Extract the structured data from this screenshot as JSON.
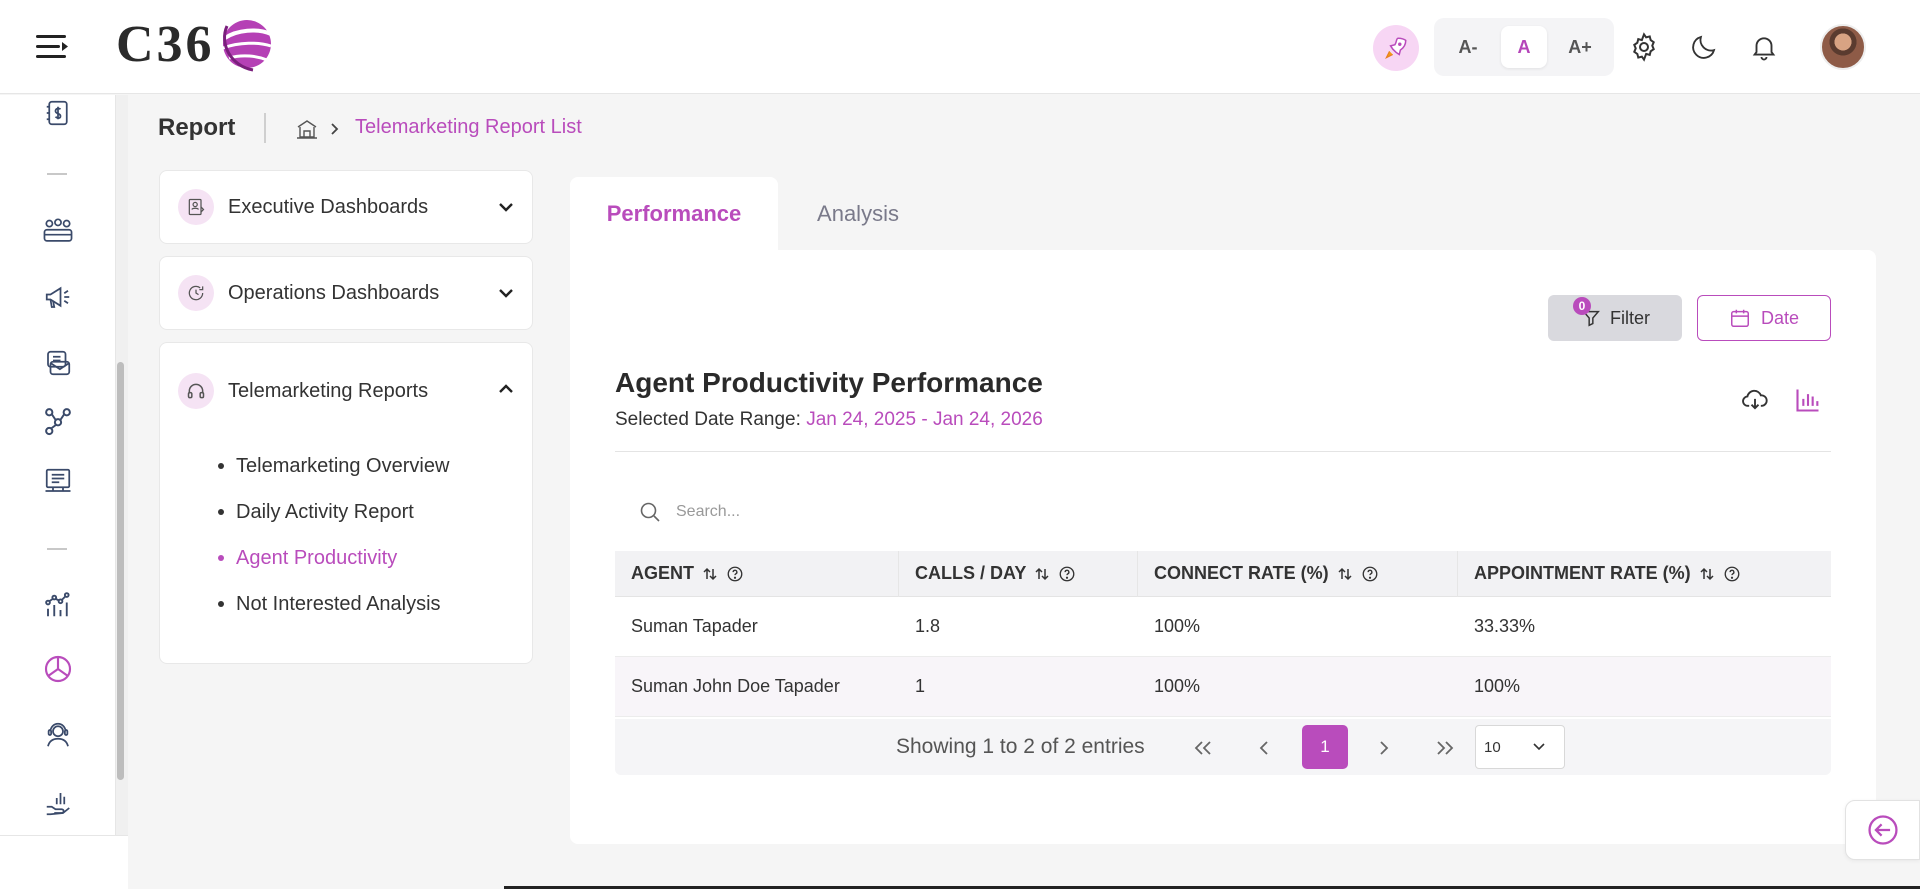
{
  "header": {
    "logo_text": "C36",
    "font_size_controls": [
      "A-",
      "A",
      "A+"
    ],
    "active_font_size": "A",
    "accent_color": "#b94cbc"
  },
  "breadcrumb": {
    "page_title": "Report",
    "current": "Telemarketing Report List"
  },
  "sidebar_menu": {
    "executive": "Executive Dashboards",
    "operations": "Operations Dashboards",
    "telemarketing": "Telemarketing Reports",
    "telemarketing_items": [
      "Telemarketing Overview",
      "Daily Activity Report",
      "Agent Productivity",
      "Not Interested Analysis"
    ],
    "active_item": "Agent Productivity"
  },
  "tabs": {
    "performance": "Performance",
    "analysis": "Analysis",
    "active": "Performance"
  },
  "toolbar": {
    "filter_label": "Filter",
    "filter_count": "0",
    "date_label": "Date"
  },
  "report": {
    "title": "Agent Productivity Performance",
    "range_label": "Selected Date Range:",
    "range_value": "Jan 24, 2025 - Jan 24, 2026"
  },
  "search": {
    "placeholder": "Search..."
  },
  "table": {
    "headers": [
      "AGENT",
      "CALLS / DAY",
      "CONNECT RATE (%)",
      "APPOINTMENT RATE (%)"
    ],
    "rows": [
      [
        "Suman Tapader",
        "1.8",
        "100%",
        "33.33%"
      ],
      [
        "Suman John Doe Tapader",
        "1",
        "100%",
        "100%"
      ]
    ]
  },
  "pagination": {
    "summary": "Showing 1 to 2 of 2 entries",
    "current_page": "1",
    "page_size": "10"
  }
}
